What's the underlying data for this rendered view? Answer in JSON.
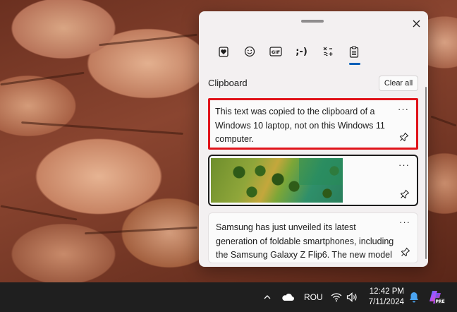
{
  "colors": {
    "accent": "#005fb8",
    "highlight_border": "#e0131a",
    "panel_bg": "#f3f0f1",
    "taskbar_bg": "#1f1f1f"
  },
  "panel": {
    "close_icon": "close-icon",
    "tabs": [
      {
        "name": "favorites",
        "icon": "heart-clipboard-icon",
        "active": false
      },
      {
        "name": "emoji",
        "icon": "smiley-icon",
        "active": false
      },
      {
        "name": "gif",
        "icon": "gif-icon",
        "label": "GIF",
        "active": false
      },
      {
        "name": "kaomoji",
        "icon": "kaomoji-icon",
        "label": ";-)",
        "active": false
      },
      {
        "name": "symbols",
        "icon": "symbols-icon",
        "active": false
      },
      {
        "name": "clipboard",
        "icon": "clipboard-icon",
        "active": true
      }
    ],
    "section_title": "Clipboard",
    "clear_all_label": "Clear all",
    "items": [
      {
        "type": "text",
        "text": "This text was copied to the clipboard of a Windows 10 laptop, not on this Windows 11 computer.",
        "more_label": "···",
        "highlighted": true
      },
      {
        "type": "image",
        "more_label": "···",
        "selected": true
      },
      {
        "type": "text",
        "text": "Samsung has just unveiled its latest generation of foldable smartphones, including the Samsung Galaxy Z Flip6. The new model is",
        "more_label": "···"
      }
    ]
  },
  "taskbar": {
    "tray_icons": [
      "chevron-up-icon",
      "onedrive-icon",
      "wifi-icon",
      "volume-icon",
      "notification-bell-icon",
      "copilot-icon"
    ],
    "language": "ROU",
    "time": "12:42 PM",
    "date": "7/11/2024",
    "copilot_badge": "PRE"
  }
}
